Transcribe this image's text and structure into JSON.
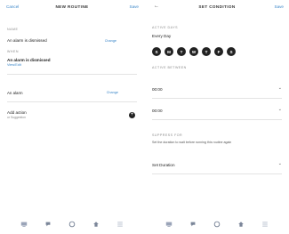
{
  "left": {
    "header": {
      "cancel": "Cancel",
      "title": "NEW ROUTINE",
      "save": "Save"
    },
    "name_section": {
      "label": "NAME",
      "value": "An alarm is dismissed",
      "change": "Change"
    },
    "when_section": {
      "label": "WHEN",
      "value": "An alarm is dismissed",
      "view_edit": "View/Edit"
    },
    "action": {
      "value": "An alarm",
      "change": "Change"
    },
    "add_action": {
      "label": "Add action",
      "sub": "or Suggestion"
    }
  },
  "right": {
    "header": {
      "title": "SET CONDITION",
      "save": "Save"
    },
    "active_days": {
      "label": "ACTIVE DAYS",
      "value": "Every Day",
      "days": [
        "S",
        "M",
        "T",
        "W",
        "T",
        "F",
        "S"
      ]
    },
    "active_between": {
      "label": "ACTIVE BETWEEN",
      "start": "00:00",
      "end": "00:00"
    },
    "suppress": {
      "label": "SUPPRESS FOR",
      "text": "Set the duration to wait before running this routine again",
      "value": "Set Duration"
    }
  },
  "nav": [
    "home-icon",
    "chat-icon",
    "play-icon",
    "devices-icon",
    "menu-icon"
  ]
}
